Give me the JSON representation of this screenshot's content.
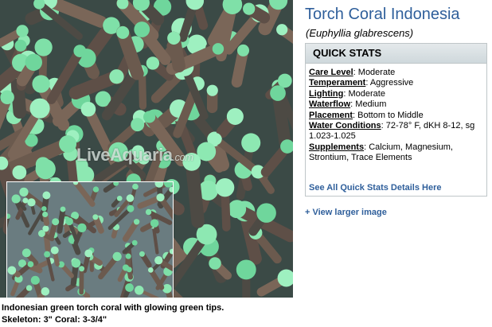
{
  "product": {
    "title": "Torch Coral Indonesia",
    "scientific_name": "(Euphyllia glabrescens)"
  },
  "image": {
    "watermark_main": "LiveAquaria",
    "watermark_suffix": ".com",
    "caption_line1": "Indonesian green torch coral with glowing green tips.",
    "caption_line2": "Skeleton: 3\" Coral: 3-3/4\""
  },
  "quick_stats": {
    "header": "QUICK STATS",
    "rows": [
      {
        "key": "Care Level",
        "value": "Moderate"
      },
      {
        "key": "Temperament",
        "value": "Aggressive"
      },
      {
        "key": "Lighting",
        "value": "Moderate"
      },
      {
        "key": "Waterflow",
        "value": "Medium"
      },
      {
        "key": "Placement",
        "value": "Bottom to Middle"
      },
      {
        "key": "Water Conditions",
        "value": "72-78° F, dKH 8-12, sg 1.023-1.025"
      },
      {
        "key": "Supplements",
        "value": "Calcium, Magnesium, Strontium, Trace Elements"
      }
    ],
    "details_link": "See All Quick Stats Details Here"
  },
  "larger_image_link": "+ View larger image",
  "colors": {
    "link_blue": "#2f5f9b",
    "tip_green": "#7fe0a8",
    "tentacle_brown": "#6b5a4e"
  }
}
